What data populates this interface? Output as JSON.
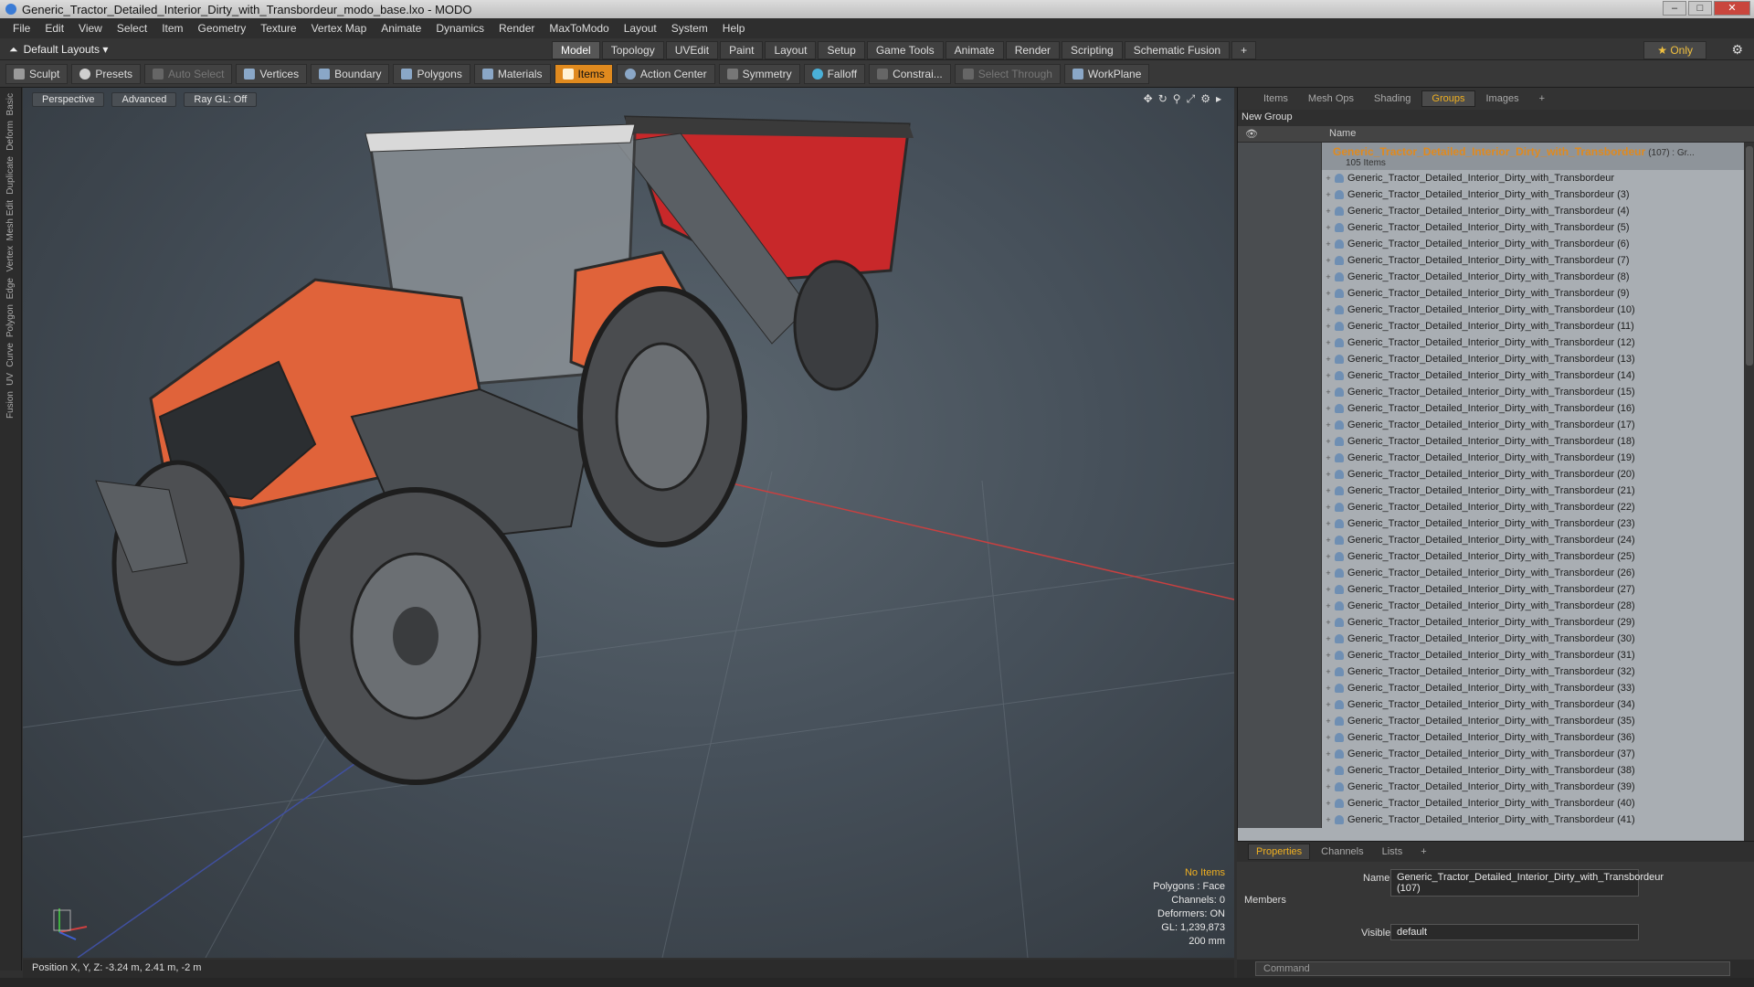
{
  "window": {
    "title": "Generic_Tractor_Detailed_Interior_Dirty_with_Transbordeur_modo_base.lxo - MODO",
    "controls": [
      "–",
      "□",
      "✕"
    ]
  },
  "menu": [
    "File",
    "Edit",
    "View",
    "Select",
    "Item",
    "Geometry",
    "Texture",
    "Vertex Map",
    "Animate",
    "Dynamics",
    "Render",
    "MaxToModo",
    "Layout",
    "System",
    "Help"
  ],
  "layout": {
    "selector": "Default Layouts ▾",
    "tabs": [
      "Model",
      "Topology",
      "UVEdit",
      "Paint",
      "Layout",
      "Setup",
      "Game Tools",
      "Animate",
      "Render",
      "Scripting",
      "Schematic Fusion",
      "+"
    ],
    "active_tab": "Model",
    "only": "★  Only"
  },
  "toolbar": {
    "sculpt": "Sculpt",
    "presets": "Presets",
    "auto_select": "Auto Select",
    "vertices": "Vertices",
    "boundary": "Boundary",
    "polygons": "Polygons",
    "materials": "Materials",
    "items": "Items",
    "action_center": "Action Center",
    "symmetry": "Symmetry",
    "falloff": "Falloff",
    "constraints": "Constrai...",
    "select_through": "Select Through",
    "workplane": "WorkPlane"
  },
  "left_strip": [
    "Basic",
    "Deform",
    "Duplicate",
    "Mesh Edit",
    "Vertex",
    "Edge",
    "Polygon",
    "Curve",
    "UV",
    "Fusion"
  ],
  "viewport": {
    "view": "Perspective",
    "advanced": "Advanced",
    "raygl": "Ray GL: Off",
    "stats": {
      "items": "No Items",
      "polygons": "Polygons : Face",
      "channels": "Channels: 0",
      "deformers": "Deformers: ON",
      "gl": "GL: 1,239,873",
      "scale": "200 mm"
    }
  },
  "statusbar": {
    "position": "Position X, Y, Z:   -3.24 m, 2.41 m, -2 m"
  },
  "right_panel": {
    "tabs": [
      "Items",
      "Mesh Ops",
      "Shading",
      "Groups",
      "Images",
      "+"
    ],
    "active_tab": "Groups",
    "new_group": "New Group",
    "col_name": "Name",
    "group": {
      "label": "Generic_Tractor_Detailed_Interior_Dirty_with_Transbordeur",
      "suffix": "(107) : Gr...",
      "count": "105 Items"
    },
    "items": [
      "Generic_Tractor_Detailed_Interior_Dirty_with_Transbordeur",
      "Generic_Tractor_Detailed_Interior_Dirty_with_Transbordeur (3)",
      "Generic_Tractor_Detailed_Interior_Dirty_with_Transbordeur (4)",
      "Generic_Tractor_Detailed_Interior_Dirty_with_Transbordeur (5)",
      "Generic_Tractor_Detailed_Interior_Dirty_with_Transbordeur (6)",
      "Generic_Tractor_Detailed_Interior_Dirty_with_Transbordeur (7)",
      "Generic_Tractor_Detailed_Interior_Dirty_with_Transbordeur (8)",
      "Generic_Tractor_Detailed_Interior_Dirty_with_Transbordeur (9)",
      "Generic_Tractor_Detailed_Interior_Dirty_with_Transbordeur (10)",
      "Generic_Tractor_Detailed_Interior_Dirty_with_Transbordeur (11)",
      "Generic_Tractor_Detailed_Interior_Dirty_with_Transbordeur (12)",
      "Generic_Tractor_Detailed_Interior_Dirty_with_Transbordeur (13)",
      "Generic_Tractor_Detailed_Interior_Dirty_with_Transbordeur (14)",
      "Generic_Tractor_Detailed_Interior_Dirty_with_Transbordeur (15)",
      "Generic_Tractor_Detailed_Interior_Dirty_with_Transbordeur (16)",
      "Generic_Tractor_Detailed_Interior_Dirty_with_Transbordeur (17)",
      "Generic_Tractor_Detailed_Interior_Dirty_with_Transbordeur (18)",
      "Generic_Tractor_Detailed_Interior_Dirty_with_Transbordeur (19)",
      "Generic_Tractor_Detailed_Interior_Dirty_with_Transbordeur (20)",
      "Generic_Tractor_Detailed_Interior_Dirty_with_Transbordeur (21)",
      "Generic_Tractor_Detailed_Interior_Dirty_with_Transbordeur (22)",
      "Generic_Tractor_Detailed_Interior_Dirty_with_Transbordeur (23)",
      "Generic_Tractor_Detailed_Interior_Dirty_with_Transbordeur (24)",
      "Generic_Tractor_Detailed_Interior_Dirty_with_Transbordeur (25)",
      "Generic_Tractor_Detailed_Interior_Dirty_with_Transbordeur (26)",
      "Generic_Tractor_Detailed_Interior_Dirty_with_Transbordeur (27)",
      "Generic_Tractor_Detailed_Interior_Dirty_with_Transbordeur (28)",
      "Generic_Tractor_Detailed_Interior_Dirty_with_Transbordeur (29)",
      "Generic_Tractor_Detailed_Interior_Dirty_with_Transbordeur (30)",
      "Generic_Tractor_Detailed_Interior_Dirty_with_Transbordeur (31)",
      "Generic_Tractor_Detailed_Interior_Dirty_with_Transbordeur (32)",
      "Generic_Tractor_Detailed_Interior_Dirty_with_Transbordeur (33)",
      "Generic_Tractor_Detailed_Interior_Dirty_with_Transbordeur (34)",
      "Generic_Tractor_Detailed_Interior_Dirty_with_Transbordeur (35)",
      "Generic_Tractor_Detailed_Interior_Dirty_with_Transbordeur (36)",
      "Generic_Tractor_Detailed_Interior_Dirty_with_Transbordeur (37)",
      "Generic_Tractor_Detailed_Interior_Dirty_with_Transbordeur (38)",
      "Generic_Tractor_Detailed_Interior_Dirty_with_Transbordeur (39)",
      "Generic_Tractor_Detailed_Interior_Dirty_with_Transbordeur (40)",
      "Generic_Tractor_Detailed_Interior_Dirty_with_Transbordeur (41)"
    ]
  },
  "properties": {
    "tabs": [
      "Properties",
      "Channels",
      "Lists",
      "+"
    ],
    "active_tab": "Properties",
    "name_label": "Name",
    "name_value": "Generic_Tractor_Detailed_Interior_Dirty_with_Transbordeur (107)",
    "members": "Members",
    "visible_label": "Visible",
    "visible_value": "default"
  },
  "command": {
    "placeholder": "Command"
  },
  "colors": {
    "accent": "#e08a1e",
    "tractor_orange": "#e0633a",
    "bin_red": "#c8282a",
    "selection": "#f0b020"
  }
}
